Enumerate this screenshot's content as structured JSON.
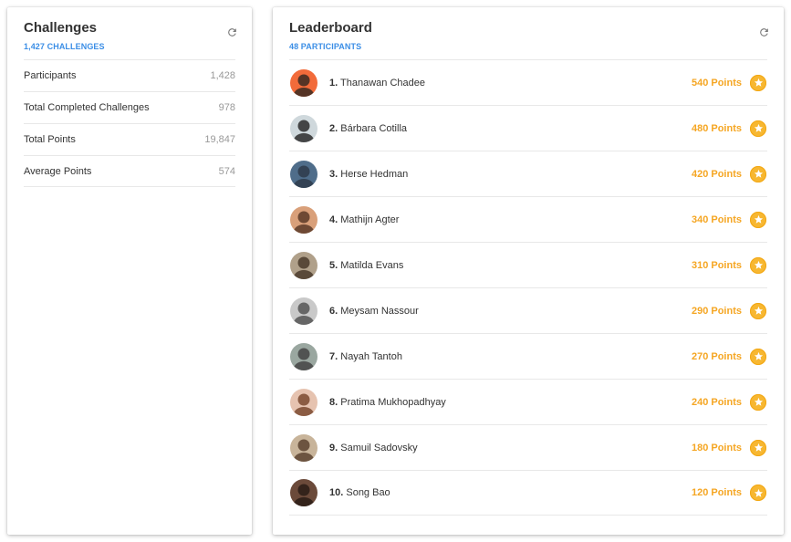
{
  "challenges": {
    "title": "Challenges",
    "subtitle": "1,427 CHALLENGES",
    "refresh_icon": "refresh-icon",
    "stats": [
      {
        "label": "Participants",
        "value": "1,428"
      },
      {
        "label": "Total Completed Challenges",
        "value": "978"
      },
      {
        "label": "Total Points",
        "value": "19,847"
      },
      {
        "label": "Average Points",
        "value": "574"
      }
    ]
  },
  "leaderboard": {
    "title": "Leaderboard",
    "subtitle": "48 PARTICIPANTS",
    "refresh_icon": "refresh-icon",
    "badge_icon": "star-icon",
    "entries": [
      {
        "rank": "1.",
        "name": "Thanawan Chadee",
        "points": "540 Points"
      },
      {
        "rank": "2.",
        "name": "Bárbara Cotilla",
        "points": "480 Points"
      },
      {
        "rank": "3.",
        "name": "Herse Hedman",
        "points": "420 Points"
      },
      {
        "rank": "4.",
        "name": "Mathijn Agter",
        "points": "340 Points"
      },
      {
        "rank": "5.",
        "name": "Matilda Evans",
        "points": "310 Points"
      },
      {
        "rank": "6.",
        "name": "Meysam Nassour",
        "points": "290 Points"
      },
      {
        "rank": "7.",
        "name": "Nayah Tantoh",
        "points": "270 Points"
      },
      {
        "rank": "8.",
        "name": "Pratima Mukhopadhyay",
        "points": "240 Points"
      },
      {
        "rank": "9.",
        "name": "Samuil Sadovsky",
        "points": "180 Points"
      },
      {
        "rank": "10.",
        "name": "Song Bao",
        "points": "120 Points"
      }
    ]
  },
  "colors": {
    "accent": "#3b8ee6",
    "points": "#f5a623",
    "badge": "#f7b731"
  }
}
